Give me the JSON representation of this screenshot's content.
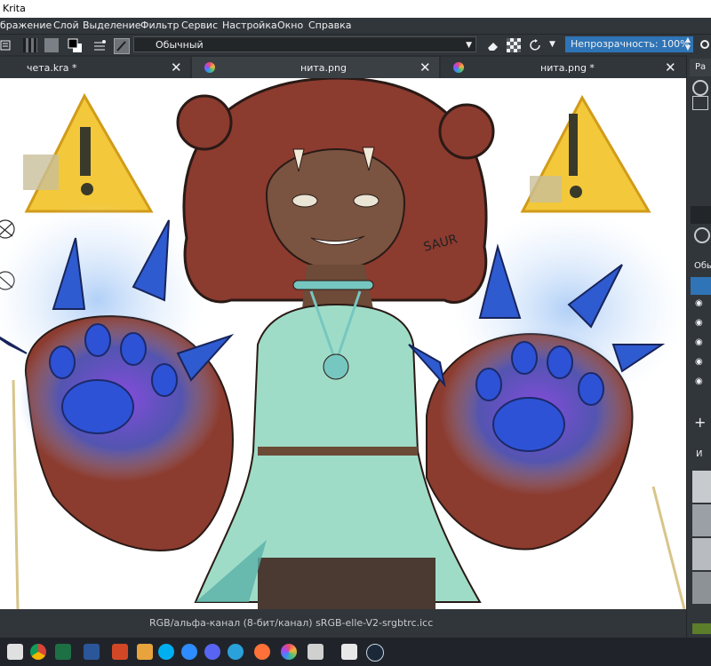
{
  "window": {
    "title": "Krita"
  },
  "menu": [
    "бражение",
    "Слой",
    "Выделение",
    "Фильтр",
    "Сервис",
    "Настройка",
    "Окно",
    "Справка"
  ],
  "toolbar": {
    "blend_mode": "Обычный",
    "opacity_label": "Непрозрачность: 100%"
  },
  "tabs": [
    {
      "label": "чета.kra *"
    },
    {
      "label": "нита.png"
    },
    {
      "label": "нита.png *"
    }
  ],
  "status": {
    "color_profile": "RGB/альфа-канал (8-бит/канал)  sRGB-elle-V2-srgbtrc.icc"
  },
  "canvas": {
    "signature": "SAUR"
  },
  "dock": {
    "tab_label": "Ра",
    "blend_label": "Обы",
    "add_symbol": "+",
    "panel_label": "И"
  },
  "colors": {
    "accent": "#2f74b6",
    "panel_bg": "#31363b",
    "canvas_bg": "#ffffff",
    "taskbar_bg": "#20242a"
  },
  "taskbar": {
    "apps": [
      "windows",
      "search",
      "chrome",
      "excel",
      "word",
      "powerpoint",
      "files",
      "skype",
      "zoom",
      "discord",
      "telegram",
      "firefox",
      "krita",
      "app",
      "app",
      "steam"
    ]
  }
}
